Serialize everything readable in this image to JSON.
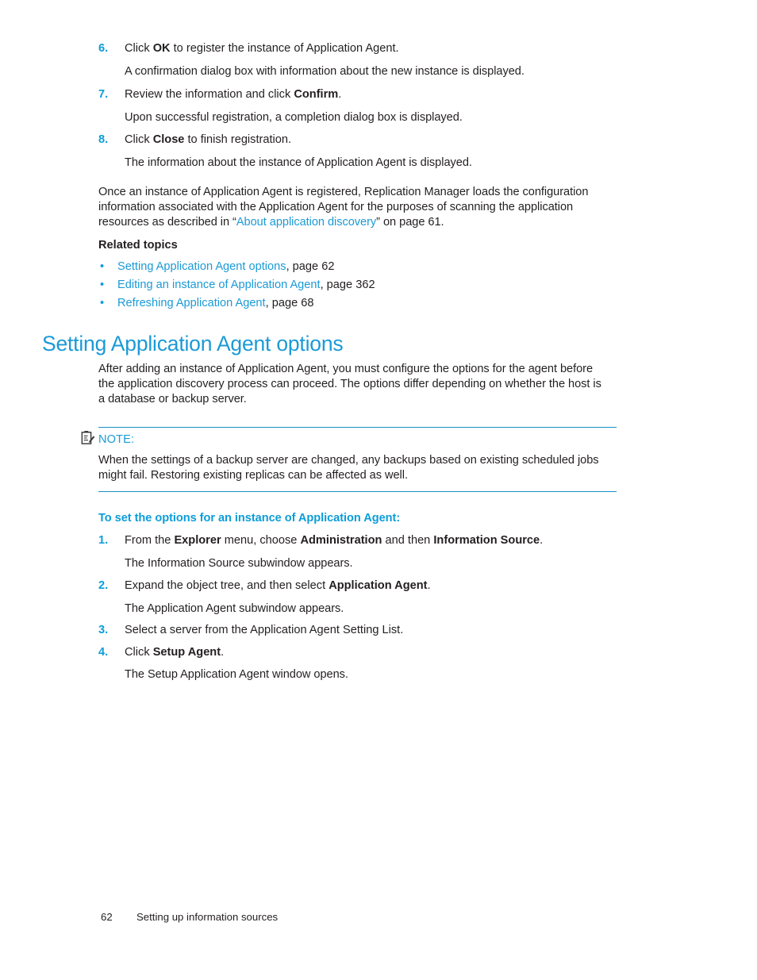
{
  "colors": {
    "heading_blue": "#1b9ad6",
    "accent_blue": "#0b9dd9",
    "rule_blue": "#1b8fc4",
    "body_text": "#231f20"
  },
  "steps_top": [
    {
      "num": "6.",
      "parts": [
        {
          "text": "Click ",
          "bold": false
        },
        {
          "text": "OK",
          "bold": true
        },
        {
          "text": " to register the instance of Application Agent.",
          "bold": false
        }
      ],
      "result": "A confirmation dialog box with information about the new instance is displayed."
    },
    {
      "num": "7.",
      "parts": [
        {
          "text": "Review the information and click ",
          "bold": false
        },
        {
          "text": "Confirm",
          "bold": true
        },
        {
          "text": ".",
          "bold": false
        }
      ],
      "result": "Upon successful registration, a completion dialog box is displayed."
    },
    {
      "num": "8.",
      "parts": [
        {
          "text": "Click ",
          "bold": false
        },
        {
          "text": "Close",
          "bold": true
        },
        {
          "text": " to finish registration.",
          "bold": false
        }
      ],
      "result": "The information about the instance of Application Agent is displayed."
    }
  ],
  "intro_paragraph": {
    "line1": "Once an instance of Application Agent is registered, Replication Manager loads the configuration",
    "line2": "information associated with the Application Agent for the purposes of scanning the application",
    "line3_pre": "resources as described in “",
    "line3_link": "About application discovery",
    "line3_post": "” on page 61."
  },
  "related": {
    "heading": "Related topics",
    "items": [
      {
        "bullet": "•",
        "link": "Setting Application Agent options",
        "suffix": ", page 62"
      },
      {
        "bullet": "•",
        "link": "Editing an instance of Application Agent",
        "suffix": ", page 362"
      },
      {
        "bullet": "•",
        "link": "Refreshing Application Agent",
        "suffix": ", page 68"
      }
    ]
  },
  "section": {
    "title": "Setting Application Agent options",
    "paragraph": {
      "line1": "After adding an instance of Application Agent, you must configure the options for the agent before",
      "line2": "the application discovery process can proceed. The options differ depending on whether the host is",
      "line3": "a database or backup server."
    }
  },
  "note": {
    "icon": "note-pencil-icon",
    "label": "NOTE:",
    "line1": "When the settings of a backup server are changed, any backups based on existing scheduled jobs",
    "line2": "might fail. Restoring existing replicas can be affected as well."
  },
  "procedure": {
    "heading": "To set the options for an instance of Application Agent:",
    "steps": [
      {
        "num": "1.",
        "parts": [
          {
            "text": "From the ",
            "bold": false
          },
          {
            "text": "Explorer",
            "bold": true
          },
          {
            "text": " menu, choose ",
            "bold": false
          },
          {
            "text": "Administration",
            "bold": true
          },
          {
            "text": " and then ",
            "bold": false
          },
          {
            "text": "Information Source",
            "bold": true
          },
          {
            "text": ".",
            "bold": false
          }
        ],
        "result": "The Information Source subwindow appears."
      },
      {
        "num": "2.",
        "parts": [
          {
            "text": "Expand the object tree, and then select ",
            "bold": false
          },
          {
            "text": "Application Agent",
            "bold": true
          },
          {
            "text": ".",
            "bold": false
          }
        ],
        "result": "The Application Agent subwindow appears."
      },
      {
        "num": "3.",
        "parts": [
          {
            "text": "Select a server from the Application Agent Setting List.",
            "bold": false
          }
        ],
        "result": ""
      },
      {
        "num": "4.",
        "parts": [
          {
            "text": "Click ",
            "bold": false
          },
          {
            "text": "Setup Agent",
            "bold": true
          },
          {
            "text": ".",
            "bold": false
          }
        ],
        "result": "The Setup Application Agent window opens."
      }
    ]
  },
  "footer": {
    "page_number": "62",
    "title": "Setting up information sources"
  }
}
